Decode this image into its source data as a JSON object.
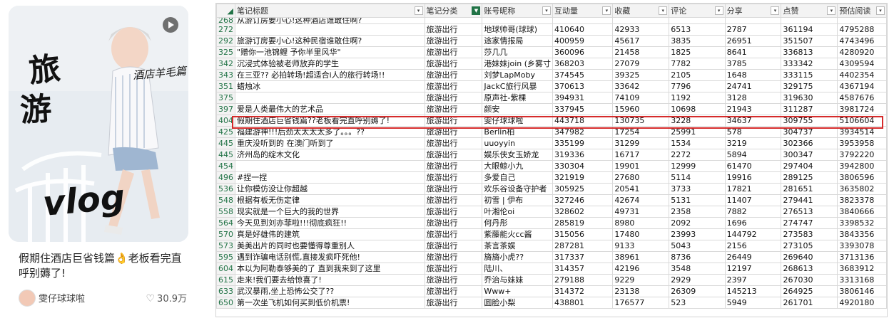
{
  "card": {
    "cover_texts": [
      "旅",
      "游",
      "酒店羊毛篇",
      "vlog"
    ],
    "title": "假期住酒店巨省钱篇👌老板看完直呼别薅了!",
    "author": "雯仔球球啦",
    "likes": "30.9万"
  },
  "sheet": {
    "columns": [
      "笔记标题",
      "笔记分类",
      "账号昵称",
      "互动量",
      "收藏",
      "评论",
      "分享",
      "点赞",
      "预估阅读"
    ],
    "partial_row": {
      "num": "268",
      "title": "从游订房要小心!这种酒店谁敢住啊?"
    },
    "rows": [
      [
        "272",
        "",
        "旅游出行",
        "地球帅哥(球球)",
        "410640",
        "42933",
        "6513",
        "2787",
        "361194",
        "4795288"
      ],
      [
        "292",
        "旅游订房要小心!这种民宿谁敢住啊?",
        "旅游出行",
        "途家情报局",
        "400959",
        "45617",
        "3835",
        "26951",
        "351507",
        "4743496"
      ],
      [
        "325",
        "\"赠你一池锦鲤 予你半里风华\"",
        "旅游出行",
        "莎几几",
        "360096",
        "21458",
        "1825",
        "8641",
        "336813",
        "4280920"
      ],
      [
        "342",
        "沉浸式体验被老师放弃的学生",
        "旅游出行",
        "港妹妹join (乡雾寸",
        "368203",
        "27079",
        "7782",
        "3785",
        "333342",
        "4309594"
      ],
      [
        "343",
        "在三亚?? 必拍转场!超适合i人的旅行转场!!",
        "旅游出行",
        "刘梦LapMoby",
        "374545",
        "39325",
        "2105",
        "1648",
        "333115",
        "4402354"
      ],
      [
        "351",
        "蜡烛冰",
        "旅游出行",
        "JackC旅行风暴",
        "370613",
        "33642",
        "7796",
        "24741",
        "329175",
        "4367194"
      ],
      [
        "375",
        "",
        "旅游出行",
        "原声社-紫棵",
        "394931",
        "74109",
        "1192",
        "3128",
        "319630",
        "4587676"
      ],
      [
        "397",
        "爱是人类最伟大的艺术品",
        "旅游出行",
        "颜安",
        "337945",
        "15960",
        "10698",
        "21943",
        "311287",
        "3981724"
      ],
      [
        "404",
        "假期住酒店巨省钱篇??老板看完直呼别薅了!",
        "旅游出行",
        "雯仔球球啦",
        "443718",
        "130735",
        "3228",
        "34637",
        "309755",
        "5106604"
      ],
      [
        "425",
        "福建游神!!!后劲太太太太多了。。。??",
        "旅游出行",
        "Berlin柏",
        "347982",
        "17254",
        "25991",
        "578",
        "304737",
        "3934514"
      ],
      [
        "445",
        "重庆没听到的 在澳门听到了",
        "旅游出行",
        "uuoyyin",
        "335199",
        "31299",
        "1534",
        "3219",
        "302366",
        "3953958"
      ],
      [
        "445",
        "济州岛的绽木文化",
        "旅游出行",
        "娱乐侠女玉娇龙",
        "319336",
        "16717",
        "2272",
        "5894",
        "300347",
        "3792220"
      ],
      [
        "454",
        "",
        "旅游出行",
        "大眼鲸小九",
        "330304",
        "19901",
        "12999",
        "61470",
        "297404",
        "3942800"
      ],
      [
        "496",
        "#捏一捏",
        "旅游出行",
        "多爱自己",
        "321919",
        "27680",
        "5114",
        "19916",
        "289125",
        "3806596"
      ],
      [
        "536",
        "让你模仿没让你超越",
        "旅游出行",
        "欢乐谷设备守护者",
        "305925",
        "20541",
        "3733",
        "17821",
        "281651",
        "3635802"
      ],
      [
        "548",
        "根据有板无伤定律",
        "旅游出行",
        "初雪 | 伊布",
        "327246",
        "42674",
        "5131",
        "11407",
        "279441",
        "3823378"
      ],
      [
        "558",
        "现实就是一个巨大的我的世界",
        "旅游出行",
        "叶湘伦oi",
        "328602",
        "49731",
        "2358",
        "7882",
        "276513",
        "3840666"
      ],
      [
        "564",
        "今天见到刘亦菲啦!!!彻底疯狂!!",
        "旅游出行",
        "何丹彤",
        "285819",
        "8980",
        "2092",
        "1696",
        "274747",
        "3398532"
      ],
      [
        "570",
        "真是好雄伟的建筑",
        "旅游出行",
        "紫藤能火cc酱",
        "315056",
        "17480",
        "23993",
        "144792",
        "273583",
        "3843356"
      ],
      [
        "573",
        "美美出片的同时也要懂得尊重别人",
        "旅游出行",
        "茶言茶娱",
        "287281",
        "9133",
        "5043",
        "2156",
        "273105",
        "3393078"
      ],
      [
        "595",
        "遇到诈骗电话别慌,直接发疯吓死他!",
        "旅游出行",
        "旖旖小虎??",
        "317337",
        "38961",
        "8736",
        "26449",
        "269640",
        "3713136"
      ],
      [
        "604",
        "本以为阿勒泰够美的了 直到我来到了这里",
        "旅游出行",
        "陆川、",
        "314357",
        "42196",
        "3548",
        "12197",
        "268613",
        "3683912"
      ],
      [
        "615",
        "走来!我们要去给惊喜了!",
        "旅游出行",
        "乔治与妹妹",
        "279188",
        "9229",
        "2929",
        "2397",
        "267030",
        "3313168"
      ],
      [
        "633",
        "武汉暴雨,坐上恐怖公交了??",
        "旅游出行",
        "Www+",
        "314372",
        "23138",
        "26309",
        "145213",
        "264925",
        "3806146"
      ],
      [
        "650",
        "第一次坐飞机如何买到低价机票!",
        "旅游出行",
        "圆脸小梨",
        "438801",
        "176577",
        "523",
        "5949",
        "261701",
        "4920180"
      ]
    ],
    "highlight_row_num": "404",
    "colors": {
      "highlight": "#d62b2b",
      "filter_button": "#217346",
      "row_num": "#217346"
    }
  }
}
